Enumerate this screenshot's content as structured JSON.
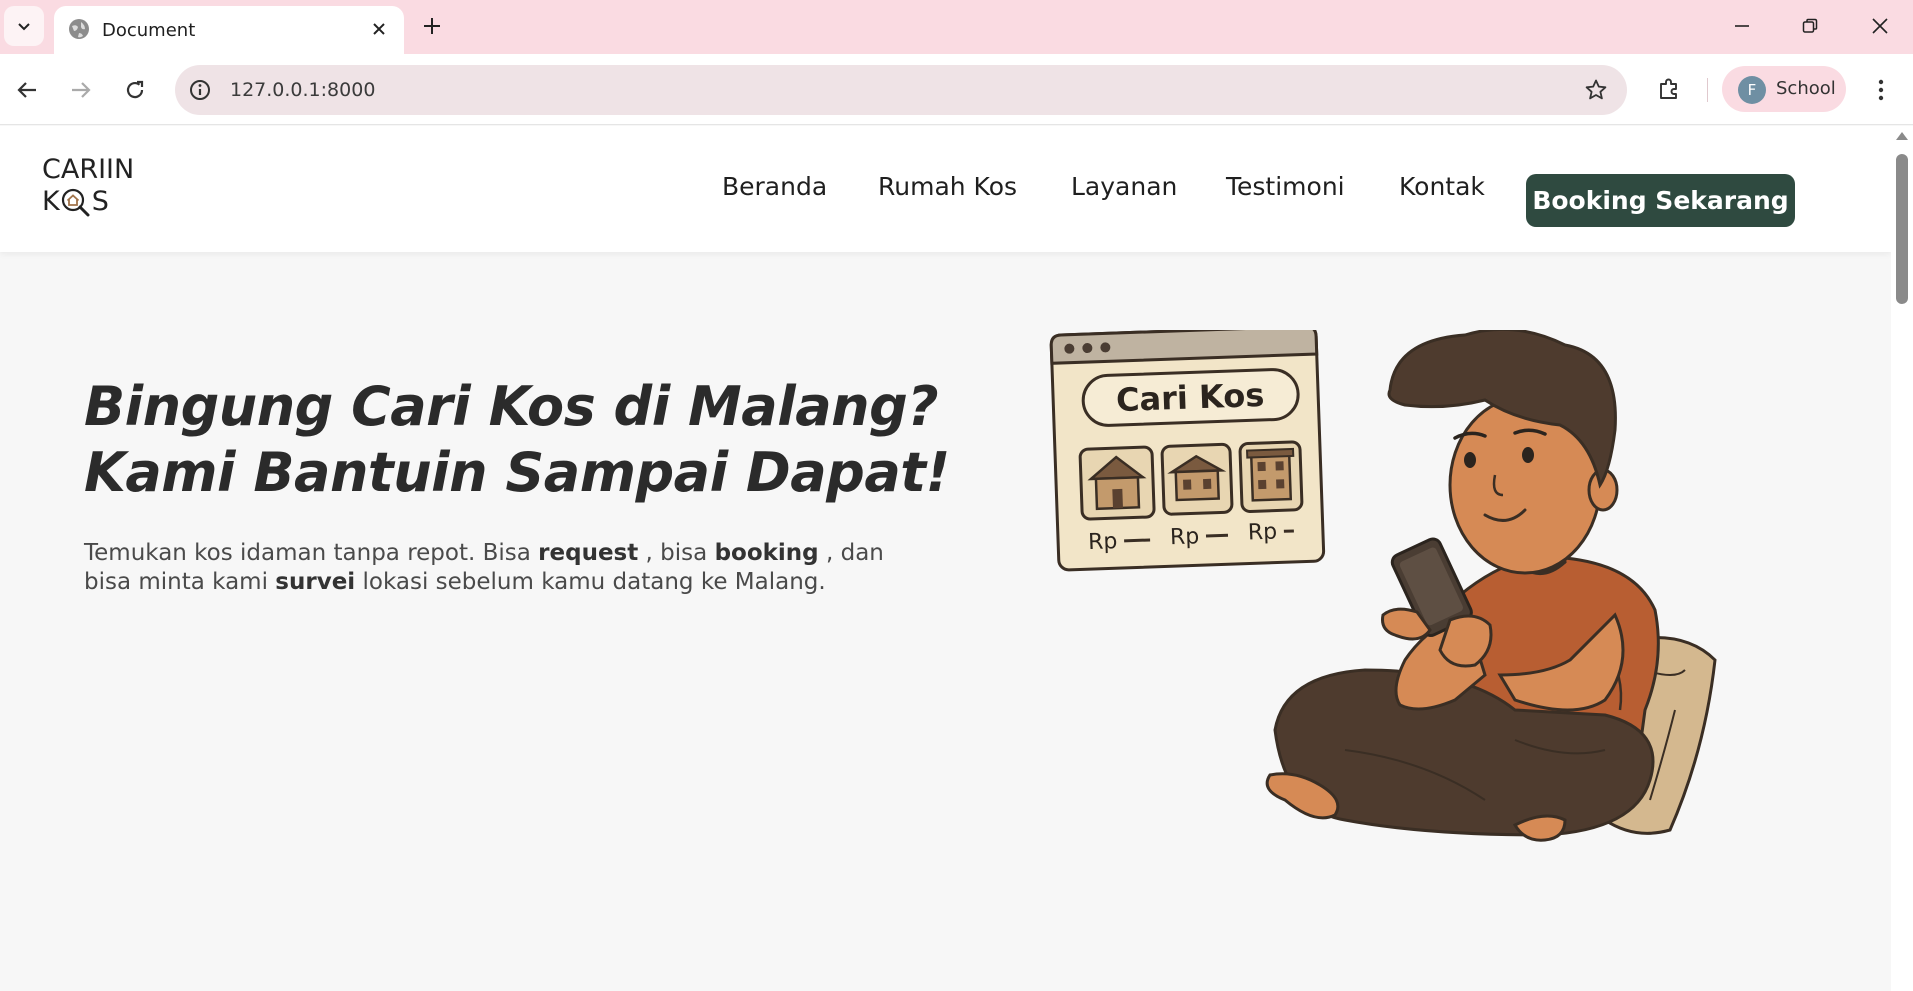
{
  "browser": {
    "tab_title": "Document",
    "url": "127.0.0.1:8000",
    "profile_initial": "F",
    "profile_name": "School"
  },
  "site": {
    "logo_line1": "CARIIN",
    "logo_k": "K",
    "logo_s": "S",
    "nav": [
      "Beranda",
      "Rumah Kos",
      "Layanan",
      "Testimoni",
      "Kontak"
    ],
    "cta": "Booking Sekarang"
  },
  "hero": {
    "title_line1": "Bingung Cari Kos di Malang?",
    "title_line2": "Kami Bantuin Sampai Dapat!",
    "sub_part1": "Temukan kos idaman tanpa repot. Bisa ",
    "sub_bold1": "request",
    "sub_part2": " , bisa ",
    "sub_bold2": "booking",
    "sub_part3": " , dan bisa minta kami ",
    "sub_bold3": "survei",
    "sub_part4": " lokasi sebelum kamu datang ke Malang."
  },
  "illustration": {
    "card_title": "Cari Kos",
    "price_label": "Rp"
  },
  "colors": {
    "tabstrip": "#fadbe2",
    "cta": "#2f4a40",
    "shirt": "#b85e32",
    "skin": "#d68a55",
    "pants": "#4e3b2e"
  }
}
